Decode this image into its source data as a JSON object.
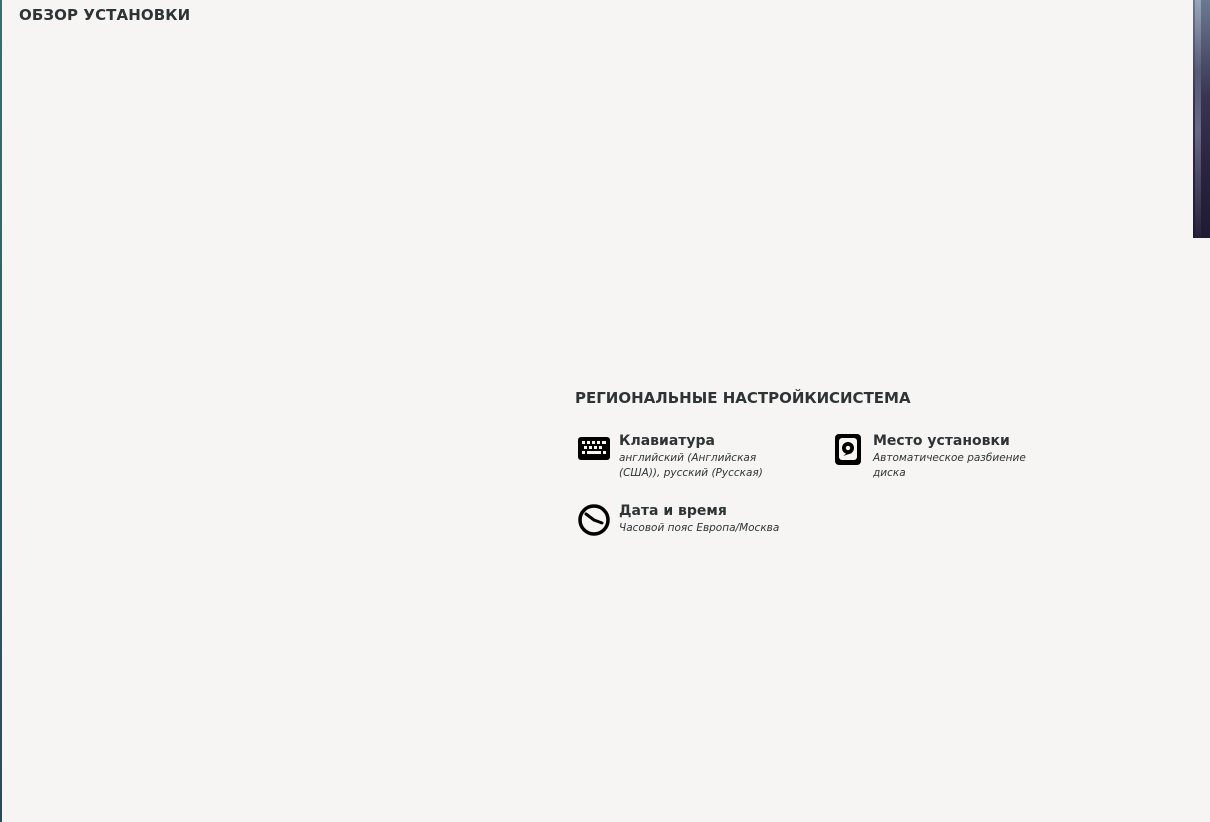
{
  "header": {
    "title": "ОБЗОР УСТАНОВКИ"
  },
  "categories": {
    "localization": {
      "title": "РЕГИОНАЛЬНЫЕ НАСТРОЙКИ",
      "spokes": [
        {
          "title": "Клавиатура",
          "status_line1": "английский (Английская",
          "status_line2": "(США)), русский (Русская)",
          "icon": "keyboard-icon"
        },
        {
          "title": "Дата и время",
          "status_line1": "Часовой пояс Европа/Москва",
          "icon": "clock-icon"
        }
      ]
    },
    "system": {
      "title": "СИСТЕМА",
      "spokes": [
        {
          "title": "Место установки",
          "status_line1": "Автоматическое разбиение",
          "status_line2": "диска",
          "icon": "harddisk-icon"
        }
      ]
    }
  },
  "colors": {
    "background": "#f6f5f4",
    "text": "#2e3436",
    "icon": "#000000"
  }
}
